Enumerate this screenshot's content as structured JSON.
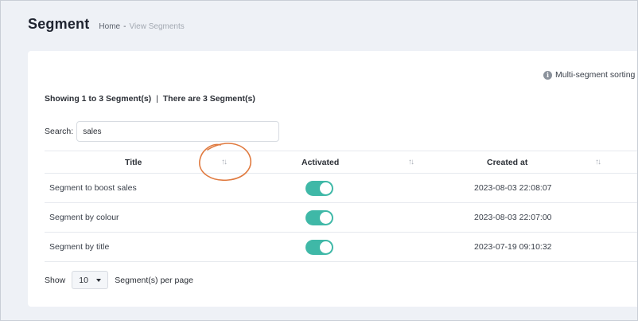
{
  "header": {
    "title": "Segment",
    "breadcrumb": {
      "home": "Home",
      "separator": "-",
      "current": "View Segments"
    }
  },
  "card": {
    "multi_sort_note": "Multi-segment sorting",
    "showing_text": "Showing 1 to 3 Segment(s)",
    "showing_separator": "|",
    "total_text": "There are 3 Segment(s)",
    "search": {
      "label": "Search:",
      "value": "sales"
    },
    "table": {
      "columns": [
        {
          "label": "Title",
          "sort_icon": "↑↓"
        },
        {
          "label": "Activated",
          "sort_icon": "↑↓"
        },
        {
          "label": "Created at",
          "sort_icon": "↑↓"
        }
      ],
      "rows": [
        {
          "title": "Segment to boost sales",
          "activated": true,
          "created_at": "2023-08-03 22:08:07"
        },
        {
          "title": "Segment by colour",
          "activated": true,
          "created_at": "2023-08-03 22:07:00"
        },
        {
          "title": "Segment by title",
          "activated": true,
          "created_at": "2023-07-19 09:10:32"
        }
      ]
    },
    "pagination": {
      "show_label": "Show",
      "per_page_value": "10",
      "per_page_suffix": "Segment(s) per page"
    }
  },
  "colors": {
    "toggle_on": "#3fb8a7",
    "annotation": "#e07a3f",
    "background": "#eef1f6"
  },
  "icons": {
    "info": "info-icon",
    "sort": "sort-icon",
    "dropdown": "chevron-down-icon"
  }
}
